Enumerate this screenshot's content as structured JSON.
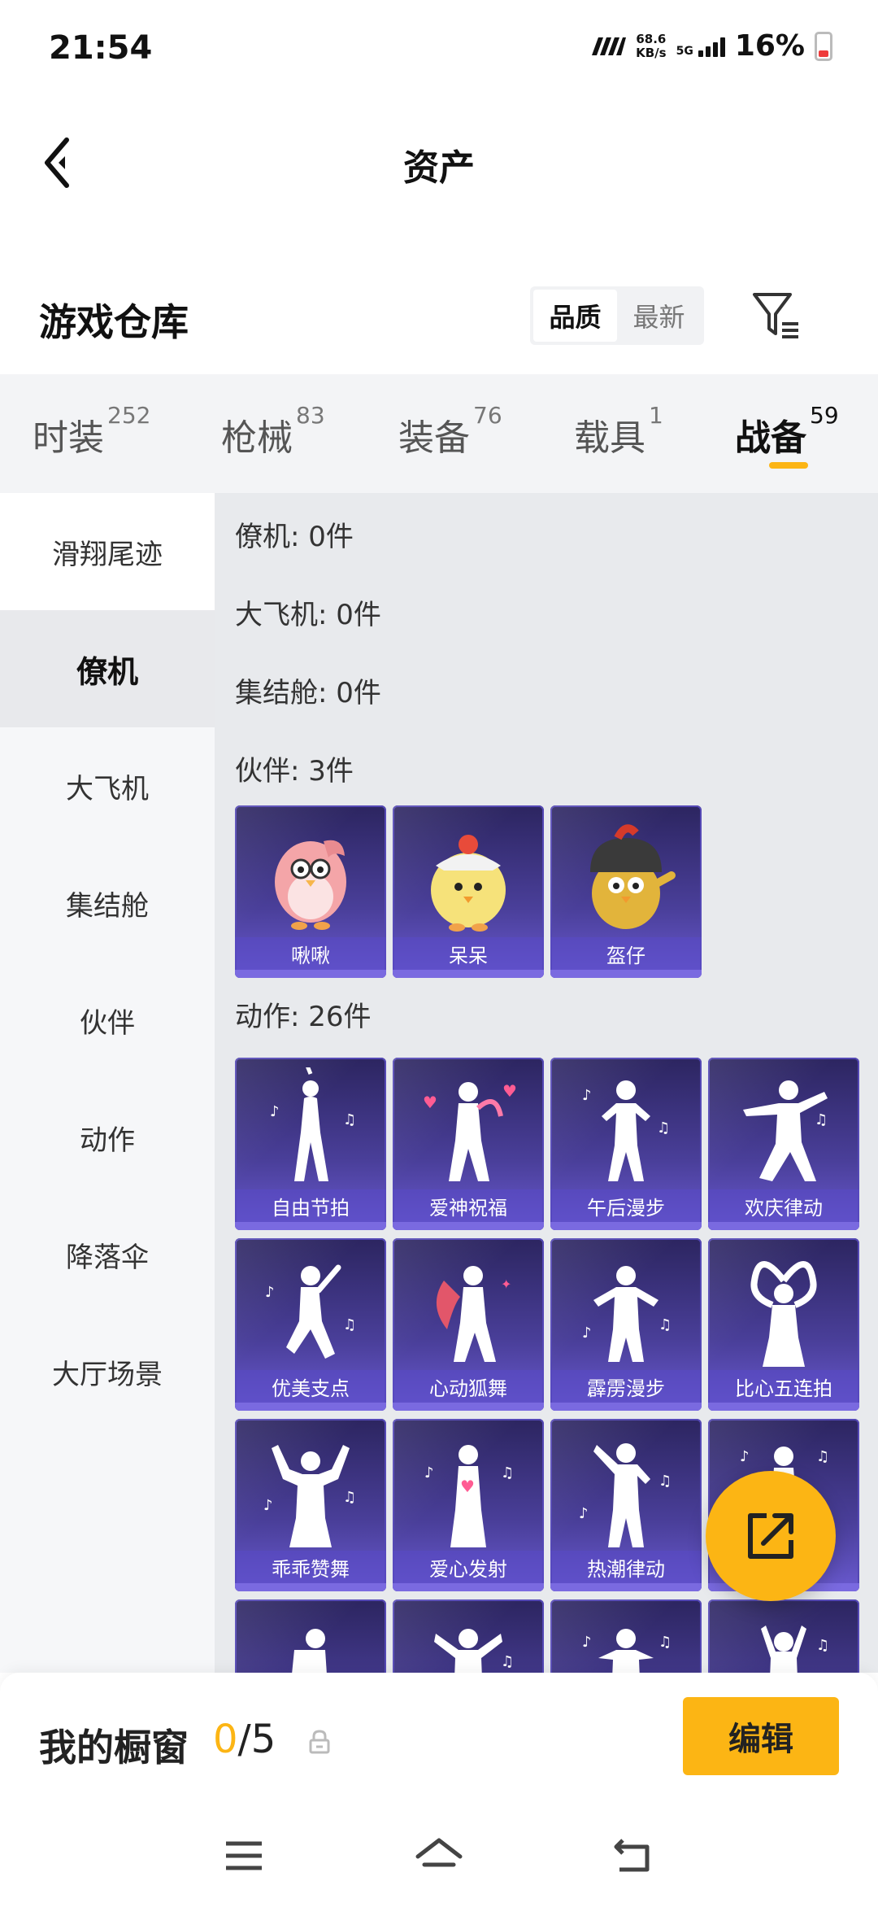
{
  "status": {
    "time": "21:54",
    "speed_value": "68.6",
    "speed_unit": "KB/s",
    "network": "5G",
    "battery": "16%"
  },
  "header": {
    "title": "资产"
  },
  "warehouse": {
    "title": "游戏仓库",
    "sort_options": [
      "品质",
      "最新"
    ],
    "active_sort": "品质"
  },
  "tabs": [
    {
      "label": "时装",
      "count": "252"
    },
    {
      "label": "枪械",
      "count": "83"
    },
    {
      "label": "装备",
      "count": "76"
    },
    {
      "label": "载具",
      "count": "1"
    },
    {
      "label": "战备",
      "count": "59"
    }
  ],
  "active_tab": "战备",
  "sidebar": {
    "items": [
      "滑翔尾迹",
      "僚机",
      "大飞机",
      "集结舱",
      "伙伴",
      "动作",
      "降落伞",
      "大厅场景"
    ],
    "active": "僚机"
  },
  "sections": {
    "wingman": "僚机: 0件",
    "plane": "大飞机: 0件",
    "pod": "集结舱: 0件",
    "partner": "伙伴: 3件",
    "emote": "动作: 26件"
  },
  "partners": [
    "啾啾",
    "呆呆",
    "盔仔"
  ],
  "emotes": [
    "自由节拍",
    "爱神祝福",
    "午后漫步",
    "欢庆律动",
    "优美支点",
    "心动狐舞",
    "霹雳漫步",
    "比心五连拍",
    "乖乖赞舞",
    "爱心发射",
    "热潮律动"
  ],
  "showcase": {
    "title": "我的橱窗",
    "current": "0",
    "total": "/5",
    "edit_label": "编辑"
  },
  "colors": {
    "accent": "#fcb514",
    "card_dark": "#2c2560",
    "card_light": "#6a5ad0"
  }
}
